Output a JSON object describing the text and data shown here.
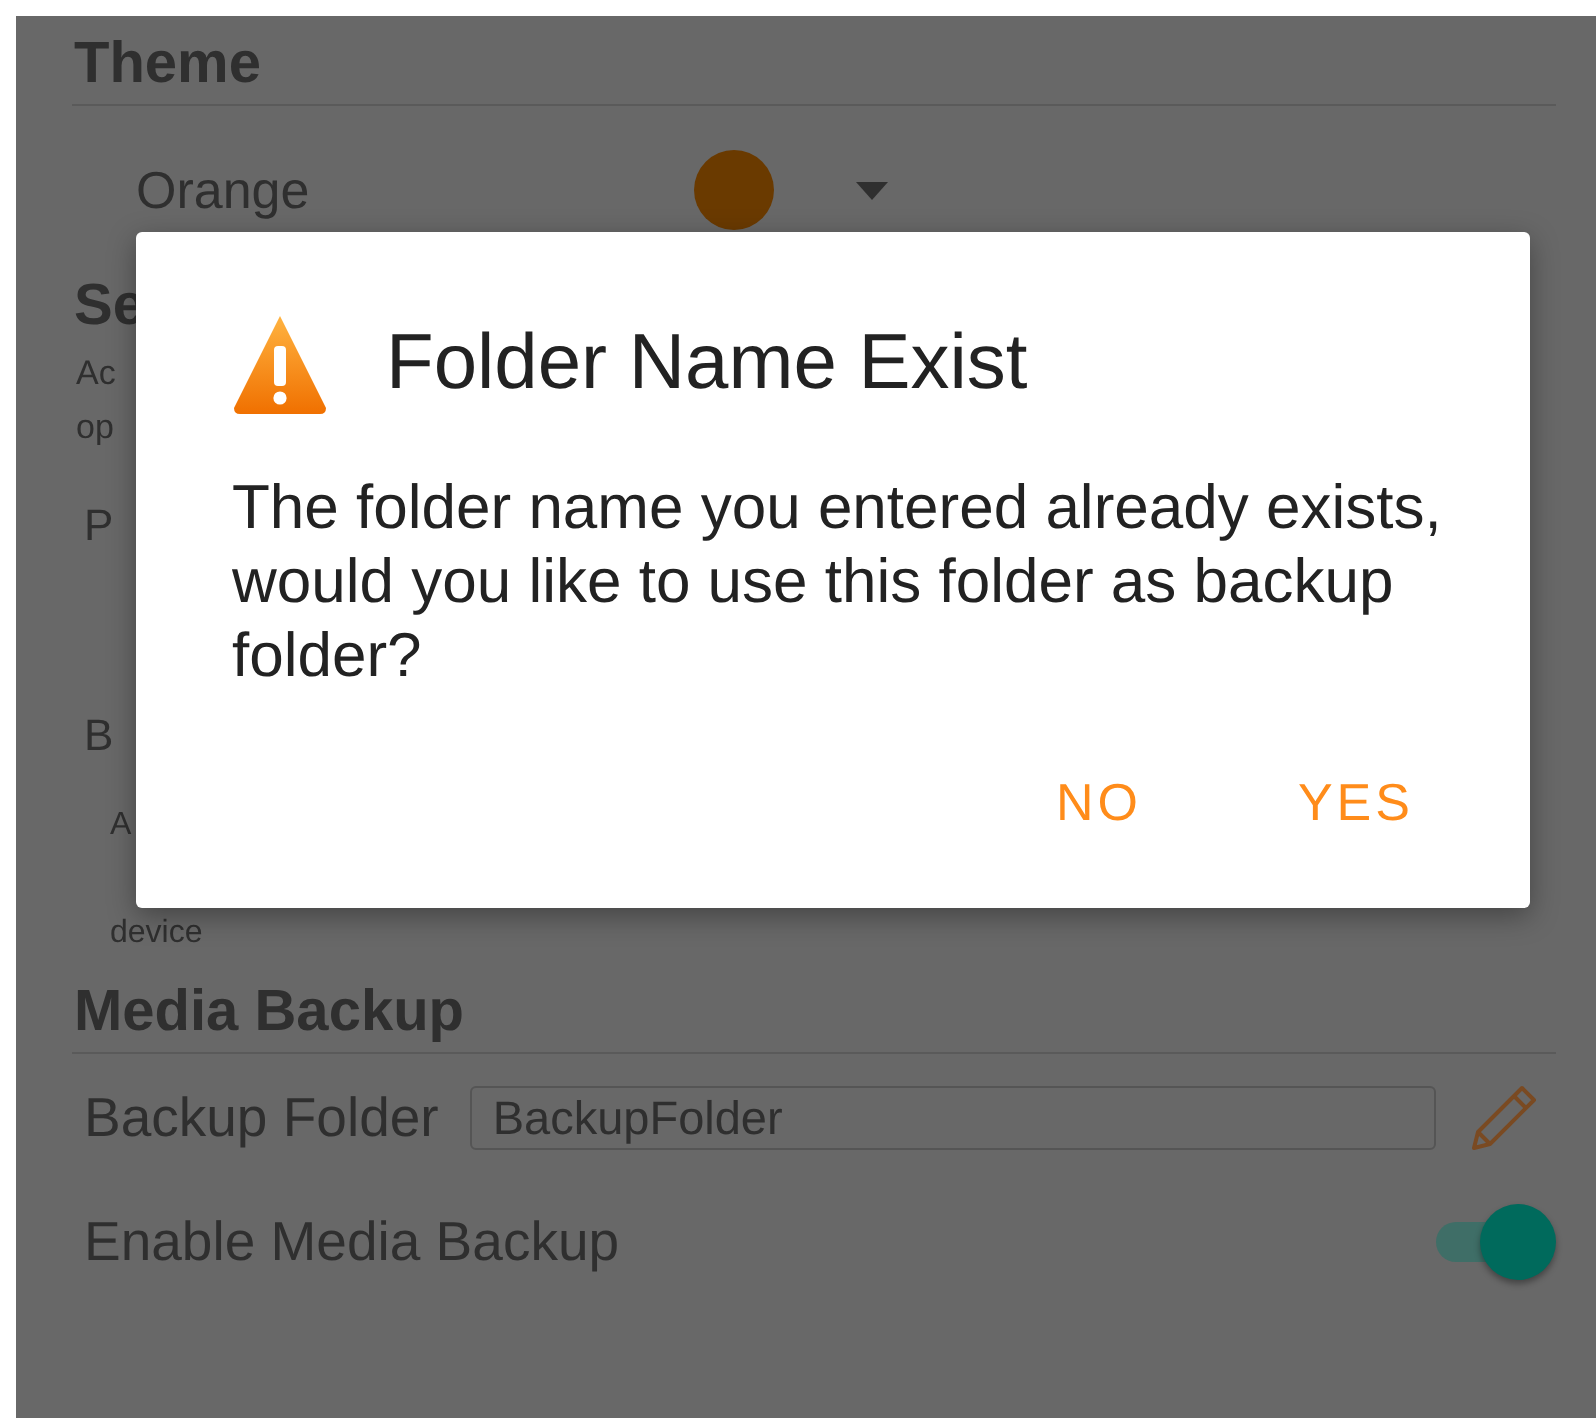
{
  "theme_section": {
    "heading": "Theme",
    "dropdown_value": "Orange"
  },
  "section_2": {
    "heading": "Se",
    "description_lines": [
      "Ac",
      "op"
    ],
    "rows": [
      {
        "label": "P",
        "description_lines": []
      },
      {
        "label": "B",
        "description_lines": [
          "A",
          "device"
        ]
      }
    ]
  },
  "media_backup_section": {
    "heading": "Media Backup",
    "backup_folder": {
      "label": "Backup Folder",
      "value": "BackupFolder"
    },
    "enable_toggle": {
      "label": "Enable Media Backup",
      "on": true
    }
  },
  "dialog": {
    "title": "Folder Name Exist",
    "message": "The folder name you entered already exists, would you like to use this folder as backup folder?",
    "buttons": [
      "NO",
      "YES"
    ]
  }
}
